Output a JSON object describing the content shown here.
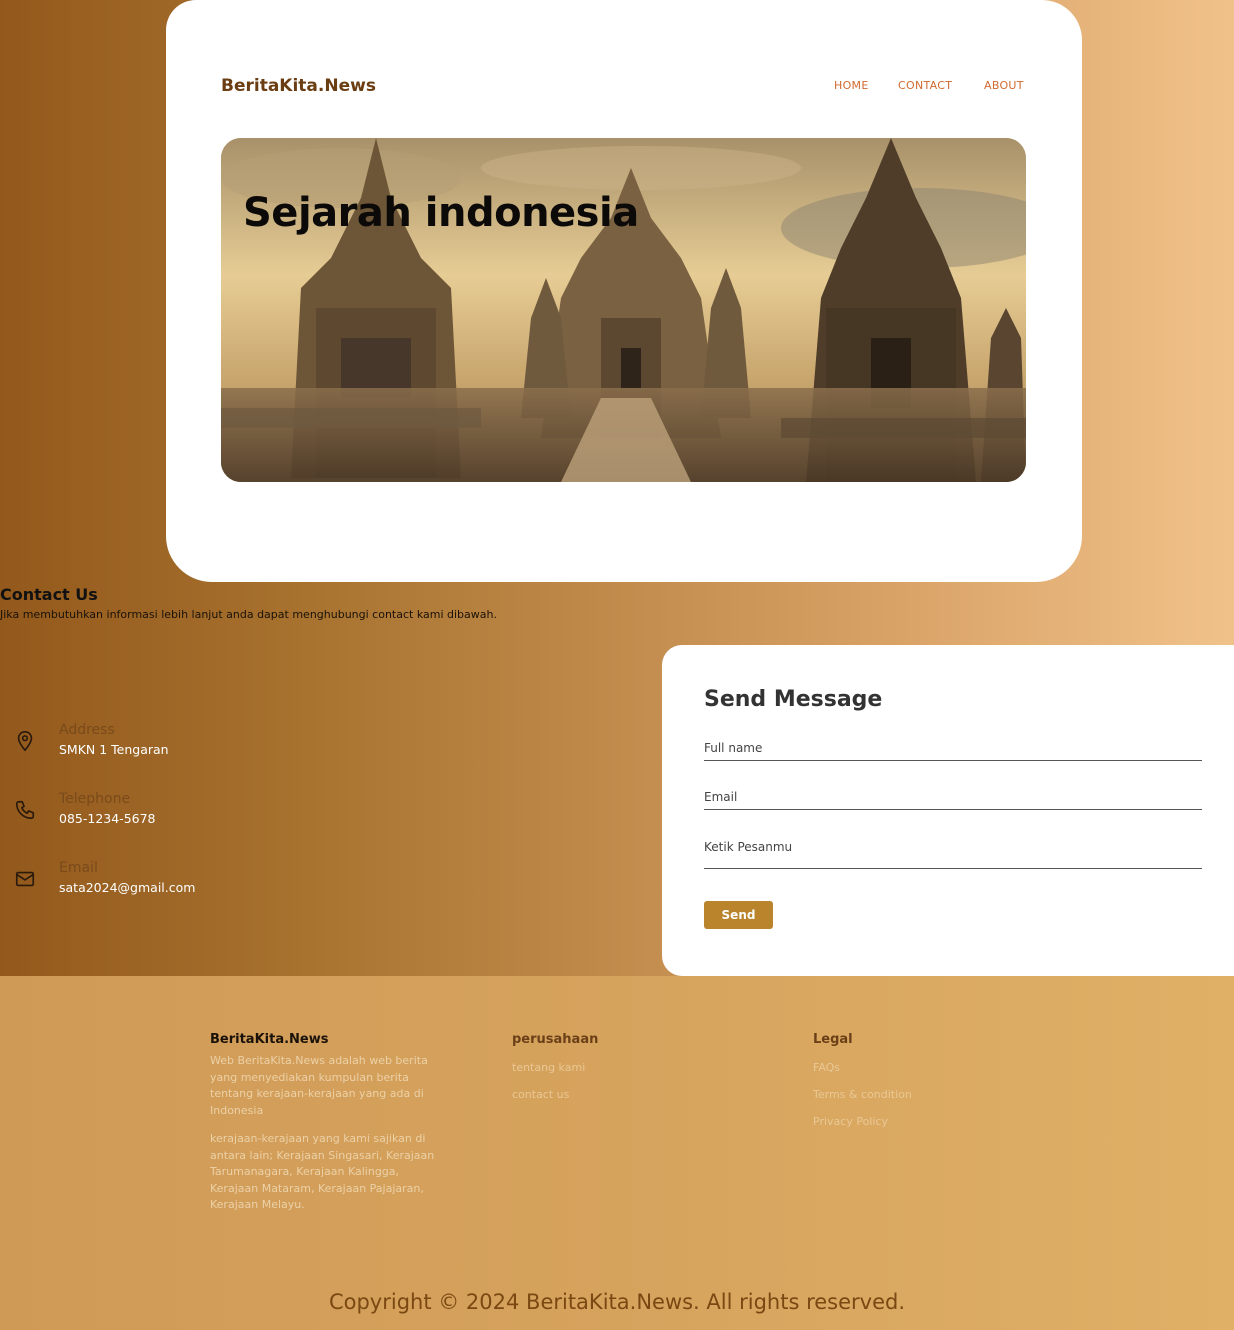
{
  "header": {
    "brand": "BeritaKita.News",
    "nav": [
      "HOME",
      "CONTACT",
      "ABOUT"
    ]
  },
  "hero": {
    "title": "Sejarah indonesia"
  },
  "contact": {
    "title": "Contact Us",
    "description": "Jika membutuhkan informasi lebih lanjut anda dapat menghubungi contact kami dibawah.",
    "items": [
      {
        "label": "Address",
        "value": "SMKN 1 Tengaran",
        "icon": "map-pin-icon"
      },
      {
        "label": "Telephone",
        "value": "085-1234-5678",
        "icon": "phone-icon"
      },
      {
        "label": "Email",
        "value": "sata2024@gmail.com",
        "icon": "mail-icon"
      }
    ]
  },
  "form": {
    "title": "Send Message",
    "fields": [
      "Full name",
      "Email",
      "Ketik Pesanmu"
    ],
    "button": "Send"
  },
  "footer": {
    "brand": "BeritaKita.News",
    "about": "Web BeritaKita.News adalah web berita yang menyediakan kumpulan berita tentang kerajaan-kerajaan yang ada di Indonesia",
    "kingdoms": "kerajaan-kerajaan yang kami sajikan di antara lain; Kerajaan Singasari, Kerajaan Tarumanagara, Kerajaan Kalingga, Kerajaan Mataram, Kerajaan Pajajaran, Kerajaan Melayu.",
    "company": {
      "title": "perusahaan",
      "links": [
        "tentang kami",
        "contact us"
      ]
    },
    "legal": {
      "title": "Legal",
      "links": [
        "FAQs",
        "Terms & condition",
        "Privacy Policy"
      ]
    },
    "copyright": "Copyright © 2024 BeritaKita.News. All rights reserved."
  },
  "colors": {
    "brand": "#6b3d12",
    "nav": "#d06a2f",
    "button": "#b9842c"
  }
}
